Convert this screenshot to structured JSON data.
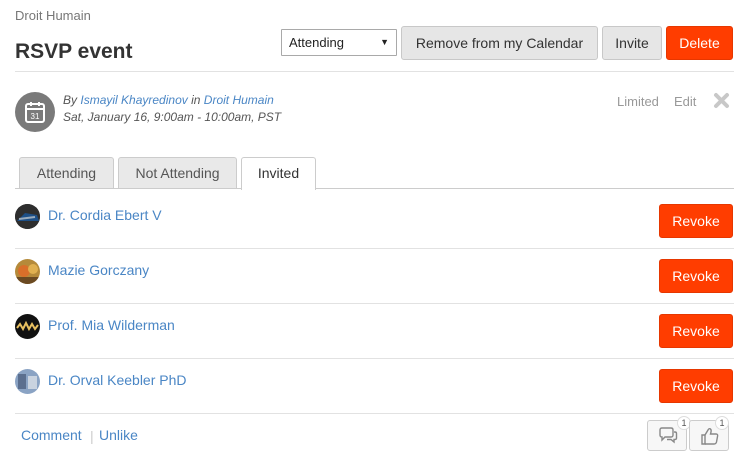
{
  "header": {
    "group_name": "Droit Humain",
    "title": "RSVP event"
  },
  "toolbar": {
    "rsvp_selected": "Attending",
    "remove_label": "Remove from my Calendar",
    "invite_label": "Invite",
    "delete_label": "Delete"
  },
  "event": {
    "by_prefix": "By",
    "author": "Ismayil Khayredinov",
    "in_word": "in",
    "group": "Droit Humain",
    "datetime": "Sat, January 16, 9:00am - 10:00am, PST",
    "calendar_day": "31",
    "access": "Limited",
    "edit_label": "Edit"
  },
  "tabs": [
    {
      "label": "Attending"
    },
    {
      "label": "Not Attending"
    },
    {
      "label": "Invited"
    }
  ],
  "invitees": [
    {
      "name": "Dr. Cordia Ebert V",
      "action": "Revoke"
    },
    {
      "name": "Mazie Gorczany",
      "action": "Revoke"
    },
    {
      "name": "Prof. Mia Wilderman",
      "action": "Revoke"
    },
    {
      "name": "Dr. Orval Keebler PhD",
      "action": "Revoke"
    }
  ],
  "footer": {
    "comment_label": "Comment",
    "separator": "|",
    "unlike_label": "Unlike",
    "comment_count": "1",
    "like_count": "1"
  },
  "colors": {
    "danger": "#ff3d00",
    "link": "#4a86c5"
  }
}
